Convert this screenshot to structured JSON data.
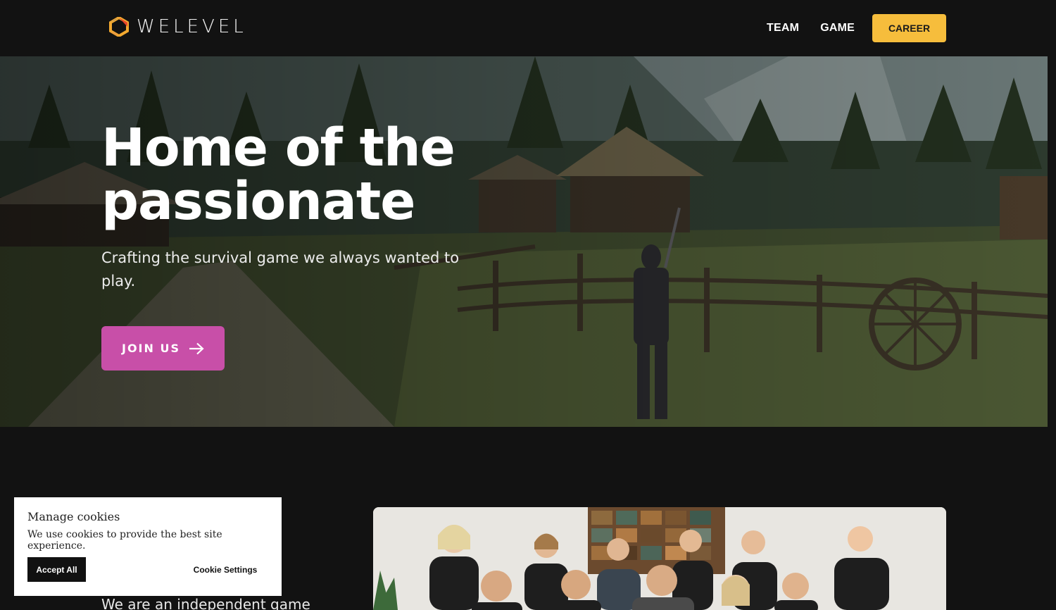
{
  "header": {
    "logo_text": "WELEVEL",
    "nav": [
      {
        "label": "TEAM"
      },
      {
        "label": "GAME"
      }
    ],
    "career_label": "CAREER"
  },
  "hero": {
    "title_line1": "Home of the",
    "title_line2": "passionate",
    "subtitle": "Crafting the survival game we always wanted to play.",
    "cta_label": "JOIN US",
    "cta_icon": "arrow-right-icon"
  },
  "intro": {
    "text": "We are an independent game"
  },
  "cookie": {
    "title": "Manage cookies",
    "text": "We use cookies to provide the best site experience.",
    "accept_label": "Accept All",
    "settings_label": "Cookie Settings"
  },
  "colors": {
    "background": "#121212",
    "accent_career": "#f6bd3c",
    "accent_join": "#c84fa8"
  }
}
